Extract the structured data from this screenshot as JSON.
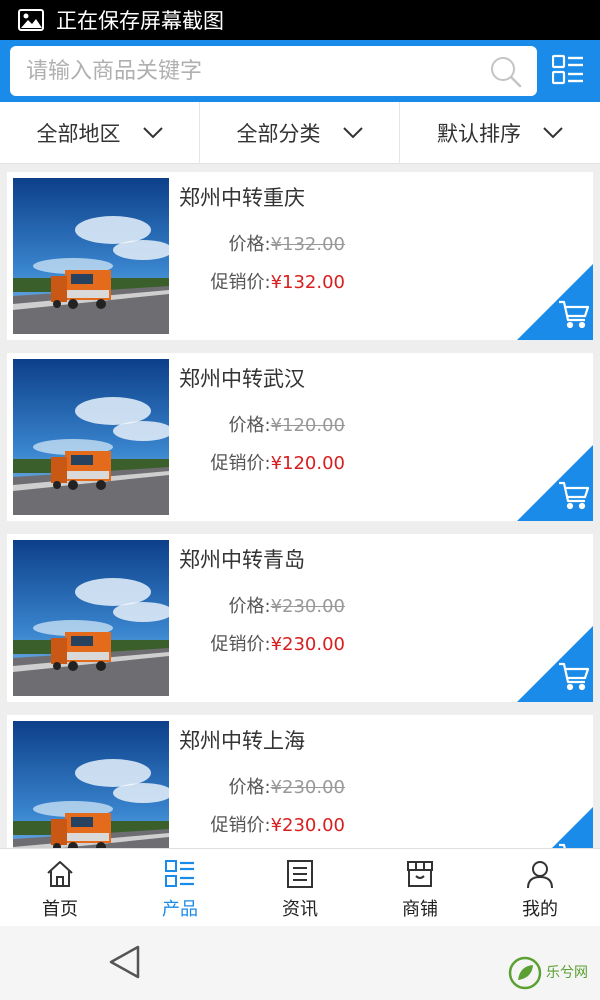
{
  "status_bar": {
    "text": "正在保存屏幕截图"
  },
  "search": {
    "placeholder": "请输入商品关键字"
  },
  "filters": [
    {
      "label": "全部地区"
    },
    {
      "label": "全部分类"
    },
    {
      "label": "默认排序"
    }
  ],
  "products": [
    {
      "name": "郑州中转重庆",
      "price_label": "价格:",
      "original_price": "¥132.00",
      "promo_label": "促销价:",
      "promo_price": "¥132.00"
    },
    {
      "name": "郑州中转武汉",
      "price_label": "价格:",
      "original_price": "¥120.00",
      "promo_label": "促销价:",
      "promo_price": "¥120.00"
    },
    {
      "name": "郑州中转青岛",
      "price_label": "价格:",
      "original_price": "¥230.00",
      "promo_label": "促销价:",
      "promo_price": "¥230.00"
    },
    {
      "name": "郑州中转上海",
      "price_label": "价格:",
      "original_price": "¥230.00",
      "promo_label": "促销价:",
      "promo_price": "¥230.00"
    }
  ],
  "bottom_nav": [
    {
      "label": "首页",
      "icon": "home-icon"
    },
    {
      "label": "产品",
      "icon": "list-icon",
      "active": true
    },
    {
      "label": "资讯",
      "icon": "news-icon"
    },
    {
      "label": "商铺",
      "icon": "shop-icon"
    },
    {
      "label": "我的",
      "icon": "user-icon"
    }
  ],
  "watermark": {
    "text": "乐兮网"
  },
  "colors": {
    "accent": "#1a8be8",
    "promo": "#d81e1e",
    "strike": "#999999"
  }
}
